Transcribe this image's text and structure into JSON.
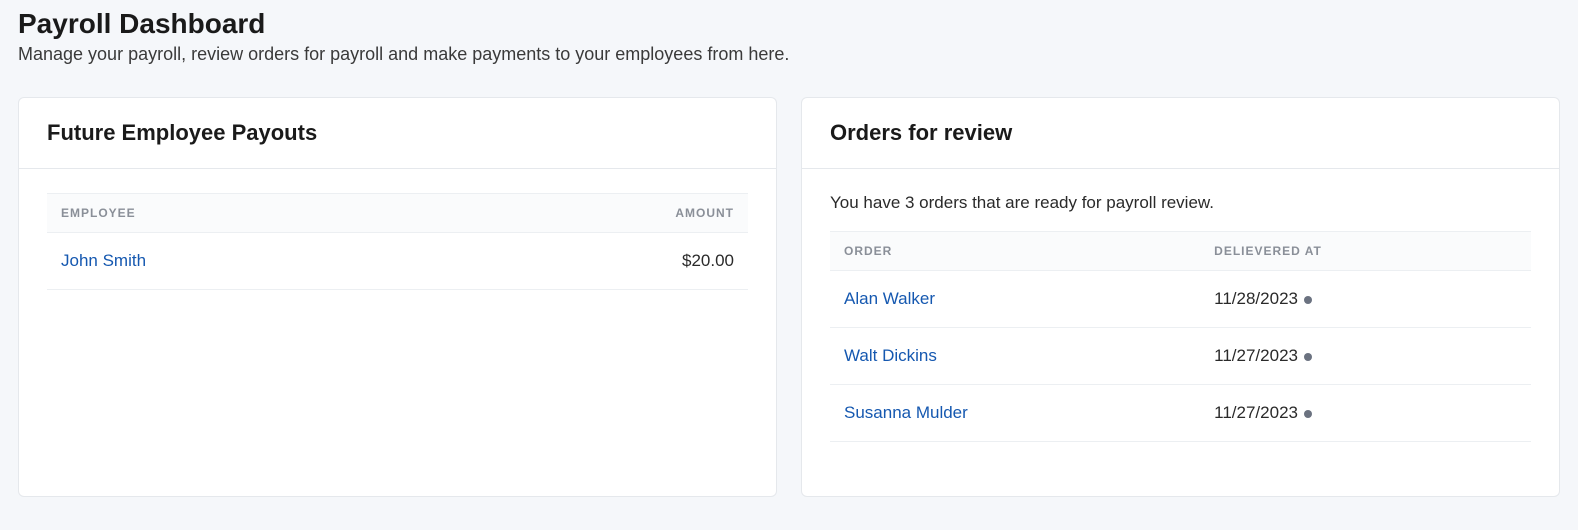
{
  "header": {
    "title": "Payroll Dashboard",
    "subtitle": "Manage your payroll, review orders for payroll and make payments to your employees from here."
  },
  "payouts": {
    "title": "Future Employee Payouts",
    "columns": {
      "employee": "Employee",
      "amount": "Amount"
    },
    "rows": [
      {
        "employee": "John Smith",
        "amount": "$20.00"
      }
    ]
  },
  "reviews": {
    "title": "Orders for review",
    "info": "You have 3 orders that are ready for payroll review.",
    "columns": {
      "order": "Order",
      "delivered": "Delievered at"
    },
    "rows": [
      {
        "order": "Alan Walker",
        "delivered": "11/28/2023"
      },
      {
        "order": "Walt Dickins",
        "delivered": "11/27/2023"
      },
      {
        "order": "Susanna Mulder",
        "delivered": "11/27/2023"
      }
    ]
  }
}
